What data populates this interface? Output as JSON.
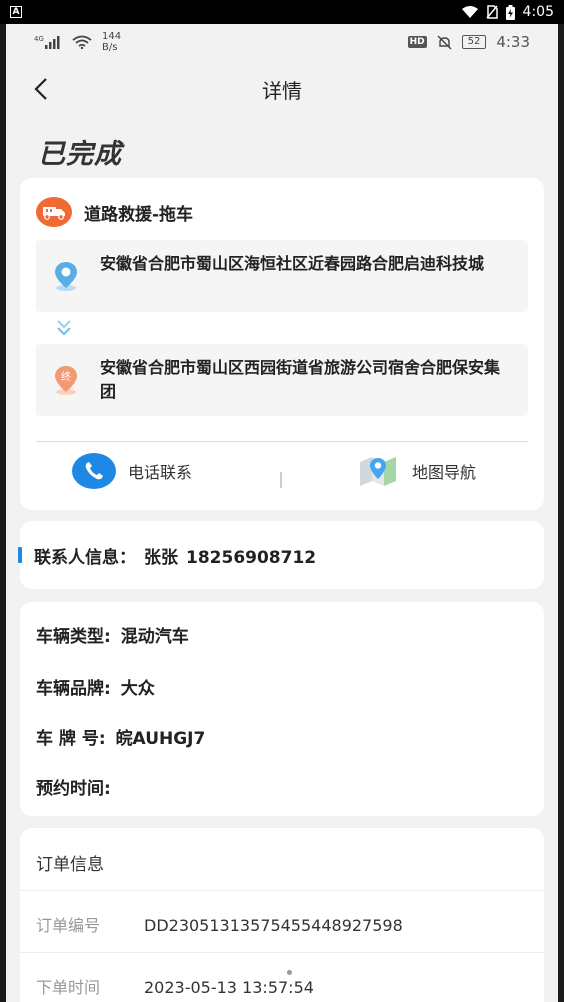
{
  "system_bar": {
    "time": "4:05",
    "app_badge": "A"
  },
  "inner_status": {
    "network": "4G",
    "speed_value": "144",
    "speed_unit": "B/s",
    "hd": "HD",
    "battery": "52",
    "time": "4:33"
  },
  "navbar": {
    "title": "详情"
  },
  "order_status": "已完成",
  "service": {
    "title": "道路救援-拖车",
    "start_address": "安徽省合肥市蜀山区海恒社区近春园路合肥启迪科技城",
    "end_label": "终",
    "end_address": "安徽省合肥市蜀山区西园街道省旅游公司宿舍合肥保安集团",
    "actions": {
      "call_label": "电话联系",
      "map_label": "地图导航"
    }
  },
  "contact": {
    "label": "联系人信息：",
    "name": "张张",
    "phone": "18256908712"
  },
  "vehicle": {
    "type_label": "车辆类型:",
    "type_value": "混动汽车",
    "brand_label": "车辆品牌:",
    "brand_value": "大众",
    "plate_label": "车 牌 号:",
    "plate_value": "皖AUHGJ7",
    "appointment_label": "预约时间:",
    "appointment_value": ""
  },
  "order": {
    "title": "订单信息",
    "number_label": "订单编号",
    "number_value": "DD23051313575455448927598",
    "time_label": "下单时间",
    "time_value": "2023-05-13 13:57:54"
  },
  "colors": {
    "accent_blue": "#1e88e5",
    "orange": "#f06a35",
    "background": "#f2f2f2"
  }
}
